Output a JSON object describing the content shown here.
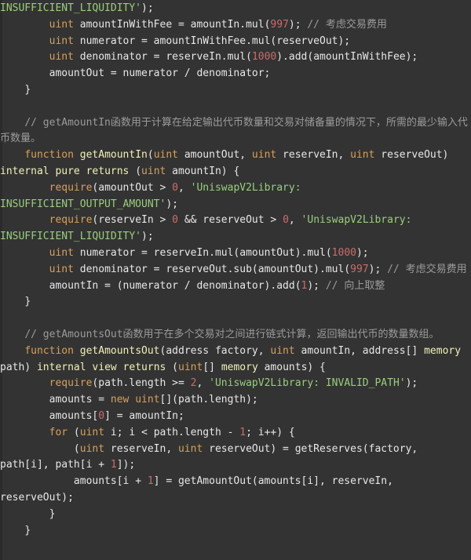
{
  "editor": {
    "language": "Solidity",
    "theme": "dark",
    "background_color": "#333333",
    "gutter_color": "#2b2b2b"
  },
  "colors": {
    "plain": "#e7e7e7",
    "keyword": "#d8a05a",
    "modifier": "#f2f0b8",
    "number": "#cc6b6b",
    "string": "#9ace7c",
    "comment": "#9b9b9b"
  },
  "code": {
    "lines": [
      {
        "id": "line-1",
        "tokens": [
          {
            "t": "str",
            "v": "INSUFFICIENT_LIQUIDITY'"
          },
          {
            "t": "plain",
            "v": ");"
          }
        ]
      },
      {
        "id": "line-2",
        "tokens": [
          {
            "t": "plain",
            "v": "        "
          },
          {
            "t": "kw",
            "v": "uint"
          },
          {
            "t": "plain",
            "v": " amountInWithFee = amountIn.mul("
          },
          {
            "t": "num",
            "v": "997"
          },
          {
            "t": "plain",
            "v": "); "
          },
          {
            "t": "cmt",
            "v": "// "
          },
          {
            "t": "cmt-cjk",
            "v": "考虑交易费用"
          }
        ]
      },
      {
        "id": "line-3",
        "tokens": [
          {
            "t": "plain",
            "v": "        "
          },
          {
            "t": "kw",
            "v": "uint"
          },
          {
            "t": "plain",
            "v": " numerator = amountInWithFee.mul(reserveOut);"
          }
        ]
      },
      {
        "id": "line-4",
        "tokens": [
          {
            "t": "plain",
            "v": "        "
          },
          {
            "t": "kw",
            "v": "uint"
          },
          {
            "t": "plain",
            "v": " denominator = reserveIn.mul("
          },
          {
            "t": "num",
            "v": "1000"
          },
          {
            "t": "plain",
            "v": ").add(amountInWithFee);"
          }
        ]
      },
      {
        "id": "line-5",
        "tokens": [
          {
            "t": "plain",
            "v": "        amountOut = numerator / denominator;"
          }
        ]
      },
      {
        "id": "line-6",
        "tokens": [
          {
            "t": "plain",
            "v": "    }"
          }
        ]
      },
      {
        "id": "line-7",
        "blank": true,
        "tokens": []
      },
      {
        "id": "line-8",
        "tokens": [
          {
            "t": "cmt",
            "v": "    // getAmountIn"
          },
          {
            "t": "cmt-cjk",
            "v": "函数用于计算在给定输出代币数量和交易对储备量的情况下，所需的最少输入代币数量。"
          }
        ]
      },
      {
        "id": "line-9",
        "tokens": [
          {
            "t": "plain",
            "v": "    "
          },
          {
            "t": "kw",
            "v": "function"
          },
          {
            "t": "plain",
            "v": " "
          },
          {
            "t": "fn",
            "v": "getAmountIn"
          },
          {
            "t": "plain",
            "v": "("
          },
          {
            "t": "kw",
            "v": "uint"
          },
          {
            "t": "plain",
            "v": " amountOut, "
          },
          {
            "t": "kw",
            "v": "uint"
          },
          {
            "t": "plain",
            "v": " reserveIn, "
          },
          {
            "t": "kw",
            "v": "uint"
          },
          {
            "t": "plain",
            "v": " reserveOut) "
          },
          {
            "t": "mod",
            "v": "internal"
          },
          {
            "t": "plain",
            "v": " "
          },
          {
            "t": "mod",
            "v": "pure"
          },
          {
            "t": "plain",
            "v": " "
          },
          {
            "t": "mod",
            "v": "returns"
          },
          {
            "t": "plain",
            "v": " ("
          },
          {
            "t": "kw",
            "v": "uint"
          },
          {
            "t": "plain",
            "v": " amountIn) {"
          }
        ]
      },
      {
        "id": "line-10",
        "tokens": [
          {
            "t": "plain",
            "v": "        "
          },
          {
            "t": "kw",
            "v": "require"
          },
          {
            "t": "plain",
            "v": "(amountOut > "
          },
          {
            "t": "num",
            "v": "0"
          },
          {
            "t": "plain",
            "v": ", "
          },
          {
            "t": "str",
            "v": "'UniswapV2Library: INSUFFICIENT_OUTPUT_AMOUNT'"
          },
          {
            "t": "plain",
            "v": ");"
          }
        ]
      },
      {
        "id": "line-11",
        "tokens": [
          {
            "t": "plain",
            "v": "        "
          },
          {
            "t": "kw",
            "v": "require"
          },
          {
            "t": "plain",
            "v": "(reserveIn > "
          },
          {
            "t": "num",
            "v": "0"
          },
          {
            "t": "plain",
            "v": " && reserveOut > "
          },
          {
            "t": "num",
            "v": "0"
          },
          {
            "t": "plain",
            "v": ", "
          },
          {
            "t": "str",
            "v": "'UniswapV2Library: INSUFFICIENT_LIQUIDITY'"
          },
          {
            "t": "plain",
            "v": ");"
          }
        ]
      },
      {
        "id": "line-12",
        "tokens": [
          {
            "t": "plain",
            "v": "        "
          },
          {
            "t": "kw",
            "v": "uint"
          },
          {
            "t": "plain",
            "v": " numerator = reserveIn.mul(amountOut).mul("
          },
          {
            "t": "num",
            "v": "1000"
          },
          {
            "t": "plain",
            "v": ");"
          }
        ]
      },
      {
        "id": "line-13",
        "tokens": [
          {
            "t": "plain",
            "v": "        "
          },
          {
            "t": "kw",
            "v": "uint"
          },
          {
            "t": "plain",
            "v": " denominator = reserveOut.sub(amountOut).mul("
          },
          {
            "t": "num",
            "v": "997"
          },
          {
            "t": "plain",
            "v": "); "
          },
          {
            "t": "cmt",
            "v": "// "
          },
          {
            "t": "cmt-cjk",
            "v": "考虑交易费用"
          }
        ]
      },
      {
        "id": "line-14",
        "tokens": [
          {
            "t": "plain",
            "v": "        amountIn = (numerator / denominator).add("
          },
          {
            "t": "num",
            "v": "1"
          },
          {
            "t": "plain",
            "v": "); "
          },
          {
            "t": "cmt",
            "v": "// "
          },
          {
            "t": "cmt-cjk",
            "v": "向上取整"
          }
        ]
      },
      {
        "id": "line-15",
        "tokens": [
          {
            "t": "plain",
            "v": "    }"
          }
        ]
      },
      {
        "id": "line-16",
        "blank": true,
        "tokens": []
      },
      {
        "id": "line-17",
        "tokens": [
          {
            "t": "cmt",
            "v": "    // getAmountsOut"
          },
          {
            "t": "cmt-cjk",
            "v": "函数用于在多个交易对之间进行链式计算，返回输出代币的数量数组。"
          }
        ]
      },
      {
        "id": "line-18",
        "tokens": [
          {
            "t": "plain",
            "v": "    "
          },
          {
            "t": "kw",
            "v": "function"
          },
          {
            "t": "plain",
            "v": " "
          },
          {
            "t": "fn",
            "v": "getAmountsOut"
          },
          {
            "t": "plain",
            "v": "(address factory, "
          },
          {
            "t": "kw",
            "v": "uint"
          },
          {
            "t": "plain",
            "v": " amountIn, address[] "
          },
          {
            "t": "mod",
            "v": "memory"
          },
          {
            "t": "plain",
            "v": " path) "
          },
          {
            "t": "mod",
            "v": "internal"
          },
          {
            "t": "plain",
            "v": " "
          },
          {
            "t": "mod",
            "v": "view"
          },
          {
            "t": "plain",
            "v": " "
          },
          {
            "t": "mod",
            "v": "returns"
          },
          {
            "t": "plain",
            "v": " ("
          },
          {
            "t": "kw",
            "v": "uint"
          },
          {
            "t": "plain",
            "v": "[] "
          },
          {
            "t": "mod",
            "v": "memory"
          },
          {
            "t": "plain",
            "v": " amounts) {"
          }
        ]
      },
      {
        "id": "line-19",
        "tokens": [
          {
            "t": "plain",
            "v": "        "
          },
          {
            "t": "kw",
            "v": "require"
          },
          {
            "t": "plain",
            "v": "(path.length >= "
          },
          {
            "t": "num",
            "v": "2"
          },
          {
            "t": "plain",
            "v": ", "
          },
          {
            "t": "str",
            "v": "'UniswapV2Library: INVALID_PATH'"
          },
          {
            "t": "plain",
            "v": ");"
          }
        ]
      },
      {
        "id": "line-20",
        "tokens": [
          {
            "t": "plain",
            "v": "        amounts = "
          },
          {
            "t": "kw",
            "v": "new"
          },
          {
            "t": "plain",
            "v": " "
          },
          {
            "t": "kw",
            "v": "uint"
          },
          {
            "t": "plain",
            "v": "[](path.length);"
          }
        ]
      },
      {
        "id": "line-21",
        "tokens": [
          {
            "t": "plain",
            "v": "        amounts["
          },
          {
            "t": "num",
            "v": "0"
          },
          {
            "t": "plain",
            "v": "] = amountIn;"
          }
        ]
      },
      {
        "id": "line-22",
        "tokens": [
          {
            "t": "plain",
            "v": "        "
          },
          {
            "t": "kw",
            "v": "for"
          },
          {
            "t": "plain",
            "v": " ("
          },
          {
            "t": "kw",
            "v": "uint"
          },
          {
            "t": "plain",
            "v": " i; i < path.length - "
          },
          {
            "t": "num",
            "v": "1"
          },
          {
            "t": "plain",
            "v": "; i++) {"
          }
        ]
      },
      {
        "id": "line-23",
        "tokens": [
          {
            "t": "plain",
            "v": "            ("
          },
          {
            "t": "kw",
            "v": "uint"
          },
          {
            "t": "plain",
            "v": " reserveIn, "
          },
          {
            "t": "kw",
            "v": "uint"
          },
          {
            "t": "plain",
            "v": " reserveOut) = getReserves(factory, path[i], path[i + "
          },
          {
            "t": "num",
            "v": "1"
          },
          {
            "t": "plain",
            "v": "]);"
          }
        ]
      },
      {
        "id": "line-24",
        "tokens": [
          {
            "t": "plain",
            "v": "            amounts[i + "
          },
          {
            "t": "num",
            "v": "1"
          },
          {
            "t": "plain",
            "v": "] = getAmountOut(amounts[i], reserveIn, reserveOut);"
          }
        ]
      },
      {
        "id": "line-25",
        "tokens": [
          {
            "t": "plain",
            "v": "        }"
          }
        ]
      },
      {
        "id": "line-26",
        "tokens": [
          {
            "t": "plain",
            "v": "    }"
          }
        ]
      }
    ]
  }
}
